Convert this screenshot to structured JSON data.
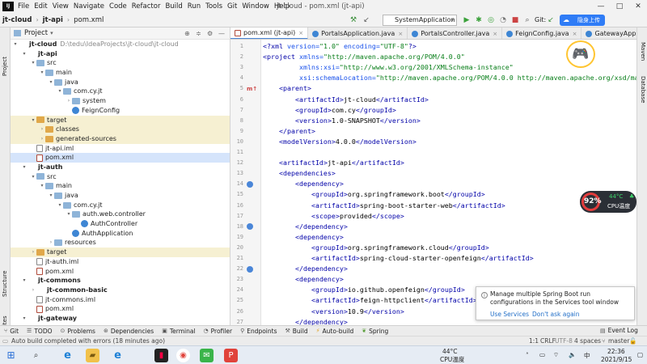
{
  "menu": {
    "items": [
      "File",
      "Edit",
      "View",
      "Navigate",
      "Code",
      "Refactor",
      "Build",
      "Run",
      "Tools",
      "Git",
      "Window",
      "Help"
    ],
    "window_title": "jt-cloud - pom.xml (jt-api)",
    "window_controls": [
      "—",
      "□",
      "✕"
    ]
  },
  "toolbar": {
    "breadcrumb": [
      "jt-cloud",
      "jt-api",
      "pom.xml"
    ],
    "run_config": "SystemApplication",
    "git_label": "Git:",
    "upload_label": "隐身上传"
  },
  "left_strip": {
    "project_label": "Project",
    "structure_label": "Structure",
    "favorites_label": "Favorites"
  },
  "right_strip": {
    "maven_label": "Maven",
    "database_label": "Database"
  },
  "project_panel": {
    "title": "Project",
    "tree": [
      {
        "level": 0,
        "arrow": "▾",
        "icon": "mod",
        "name": "jt-cloud",
        "bold": true,
        "extra": "D:\\tedu\\IdeaProjects\\jt-cloud\\jt-cloud"
      },
      {
        "level": 1,
        "arrow": "▾",
        "icon": "mod",
        "name": "jt-api",
        "bold": true,
        "extra": ""
      },
      {
        "level": 2,
        "arrow": "▾",
        "icon": "folder",
        "name": "src",
        "bold": false,
        "extra": ""
      },
      {
        "level": 3,
        "arrow": "▾",
        "icon": "folder",
        "name": "main",
        "bold": false,
        "extra": ""
      },
      {
        "level": 4,
        "arrow": "▾",
        "icon": "folder",
        "name": "java",
        "bold": false,
        "extra": ""
      },
      {
        "level": 5,
        "arrow": "▾",
        "icon": "folder",
        "name": "com.cy.jt",
        "bold": false,
        "extra": ""
      },
      {
        "level": 6,
        "arrow": "›",
        "icon": "folder",
        "name": "system",
        "bold": false,
        "extra": ""
      },
      {
        "level": 6,
        "arrow": "",
        "icon": "cls",
        "name": "FeignConfig",
        "bold": false,
        "extra": ""
      },
      {
        "level": 2,
        "arrow": "▾",
        "icon": "folder orange",
        "name": "target",
        "bold": false,
        "extra": "",
        "hl": true
      },
      {
        "level": 3,
        "arrow": "›",
        "icon": "folder orange",
        "name": "classes",
        "bold": false,
        "extra": "",
        "hl": true
      },
      {
        "level": 3,
        "arrow": "›",
        "icon": "folder orange",
        "name": "generated-sources",
        "bold": false,
        "extra": "",
        "hl": true
      },
      {
        "level": 2,
        "arrow": "",
        "icon": "file-iml",
        "name": "jt-api.iml",
        "bold": false,
        "extra": ""
      },
      {
        "level": 2,
        "arrow": "",
        "icon": "file-xml",
        "name": "pom.xml",
        "bold": false,
        "extra": "",
        "sel": true
      },
      {
        "level": 1,
        "arrow": "▾",
        "icon": "mod",
        "name": "jt-auth",
        "bold": true,
        "extra": ""
      },
      {
        "level": 2,
        "arrow": "▾",
        "icon": "folder",
        "name": "src",
        "bold": false,
        "extra": ""
      },
      {
        "level": 3,
        "arrow": "▾",
        "icon": "folder",
        "name": "main",
        "bold": false,
        "extra": ""
      },
      {
        "level": 4,
        "arrow": "▾",
        "icon": "folder",
        "name": "java",
        "bold": false,
        "extra": ""
      },
      {
        "level": 5,
        "arrow": "▾",
        "icon": "folder",
        "name": "com.cy.jt",
        "bold": false,
        "extra": ""
      },
      {
        "level": 6,
        "arrow": "▾",
        "icon": "folder",
        "name": "auth.web.controller",
        "bold": false,
        "extra": ""
      },
      {
        "level": 7,
        "arrow": "",
        "icon": "cls",
        "name": "AuthController",
        "bold": false,
        "extra": ""
      },
      {
        "level": 6,
        "arrow": "",
        "icon": "cls",
        "name": "AuthApplication",
        "bold": false,
        "extra": ""
      },
      {
        "level": 4,
        "arrow": "›",
        "icon": "folder",
        "name": "resources",
        "bold": false,
        "extra": ""
      },
      {
        "level": 2,
        "arrow": "›",
        "icon": "folder orange",
        "name": "target",
        "bold": false,
        "extra": "",
        "hl": true
      },
      {
        "level": 2,
        "arrow": "",
        "icon": "file-iml",
        "name": "jt-auth.iml",
        "bold": false,
        "extra": ""
      },
      {
        "level": 2,
        "arrow": "",
        "icon": "file-xml",
        "name": "pom.xml",
        "bold": false,
        "extra": ""
      },
      {
        "level": 1,
        "arrow": "▾",
        "icon": "mod",
        "name": "jt-commons",
        "bold": true,
        "extra": ""
      },
      {
        "level": 2,
        "arrow": "›",
        "icon": "mod",
        "name": "jt-common-basic",
        "bold": true,
        "extra": ""
      },
      {
        "level": 2,
        "arrow": "",
        "icon": "file-iml",
        "name": "jt-commons.iml",
        "bold": false,
        "extra": ""
      },
      {
        "level": 2,
        "arrow": "",
        "icon": "file-xml",
        "name": "pom.xml",
        "bold": false,
        "extra": ""
      },
      {
        "level": 1,
        "arrow": "▾",
        "icon": "mod",
        "name": "jt-gateway",
        "bold": true,
        "extra": ""
      }
    ]
  },
  "editor_tabs": [
    {
      "label": "pom.xml (jt-api)",
      "type": "xml",
      "active": true
    },
    {
      "label": "PortalsApplication.java",
      "type": "java",
      "active": false
    },
    {
      "label": "PortalsController.java",
      "type": "java",
      "active": false
    },
    {
      "label": "FeignConfig.java",
      "type": "java",
      "active": false
    },
    {
      "label": "GatewayApplication.java",
      "type": "java",
      "active": false
    }
  ],
  "editor": {
    "line_numbers": [
      "1",
      "2",
      "3",
      "4",
      "5",
      "6",
      "7",
      "8",
      "9",
      "10",
      "11",
      "12",
      "13",
      "14",
      "15",
      "16",
      "17",
      "18",
      "19",
      "20",
      "21",
      "22",
      "23",
      "24",
      "25",
      "26",
      "27"
    ],
    "gutter_marks": [
      {
        "line": 5,
        "kind": "m",
        "text": "m↑"
      },
      {
        "line": 14,
        "kind": "dot",
        "text": ""
      },
      {
        "line": 18,
        "kind": "dot",
        "text": ""
      },
      {
        "line": 22,
        "kind": "dot",
        "text": ""
      }
    ],
    "lines": [
      "<?xml version=\"1.0\" encoding=\"UTF-8\"?>",
      "<project xmlns=\"http://maven.apache.org/POM/4.0.0\"",
      "         xmlns:xsi=\"http://www.w3.org/2001/XMLSchema-instance\"",
      "         xsi:schemaLocation=\"http://maven.apache.org/POM/4.0.0 http://maven.apache.org/xsd/maven-4",
      "    <parent>",
      "        <artifactId>jt-cloud</artifactId>",
      "        <groupId>com.cy</groupId>",
      "        <version>1.0-SNAPSHOT</version>",
      "    </parent>",
      "    <modelVersion>4.0.0</modelVersion>",
      "",
      "    <artifactId>jt-api</artifactId>",
      "    <dependencies>",
      "        <dependency>",
      "            <groupId>org.springframework.boot</groupId>",
      "            <artifactId>spring-boot-starter-web</artifactId>",
      "            <scope>provided</scope>",
      "        </dependency>",
      "        <dependency>",
      "            <groupId>org.springframework.cloud</groupId>",
      "            <artifactId>spring-cloud-starter-openfeign</artifactId>",
      "        </dependency>",
      "        <dependency>",
      "            <groupId>io.github.openfeign</groupId>",
      "            <artifactId>feign-httpclient</artifactId>",
      "            <version>10.9</version>",
      "        </dependency>"
    ]
  },
  "notification": {
    "text": "Manage multiple Spring Boot run configurations in the Services tool window",
    "link_use": "Use Services",
    "link_dismiss": "Don't ask again"
  },
  "cpu_widget": {
    "percent": "92%",
    "temperature": "44°C",
    "label": "CPU温度"
  },
  "bottom_tabs": [
    "Git",
    "TODO",
    "Problems",
    "Dependencies",
    "Terminal",
    "Profiler",
    "Endpoints",
    "Build",
    "Auto-build",
    "Spring"
  ],
  "event_log": "Event Log",
  "status": {
    "message": "Auto build completed with errors (18 minutes ago)",
    "position": "1:1",
    "line_sep": "CRLF",
    "encoding": "UTF-8",
    "indent": "4 spaces",
    "branch": "master"
  },
  "taskbar": {
    "cpu_temp": "44°C",
    "cpu_label": "CPU温度",
    "time": "22:36",
    "date": "2021/9/15",
    "input_method": "中"
  },
  "colors": {
    "tag": "#0000a8",
    "attr": "#1750eb",
    "value": "#067d17",
    "selection": "#d5e4fb",
    "accent": "#2f7cf6"
  }
}
